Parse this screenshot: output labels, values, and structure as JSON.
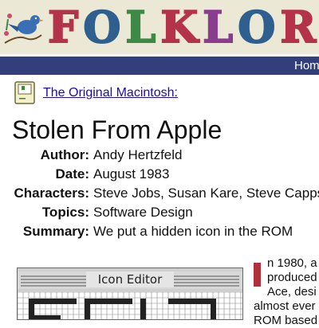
{
  "banner": {
    "logo_text": "FOLKLORE",
    "logo_colors": [
      "#b5334a",
      "#2f5f8f",
      "#3d8a46",
      "#b5334a",
      "#8a3d8f",
      "#2f5f8f",
      "#b5334a",
      "#3d8a46"
    ],
    "bird_icon": "bluebird-icon"
  },
  "nav": {
    "home_label": "Home"
  },
  "section": {
    "icon": "macintosh-icon",
    "link_text": "The Original Macintosh:"
  },
  "story": {
    "title": "Stolen From Apple",
    "meta": [
      {
        "label": "Author:",
        "value": "Andy Hertzfeld"
      },
      {
        "label": "Date:",
        "value": "August 1983"
      },
      {
        "label": "Characters:",
        "value": "Steve Jobs, Susan Kare, Steve Capps"
      },
      {
        "label": "Topics:",
        "value": "Software Design"
      },
      {
        "label": "Summary:",
        "value": "We put a hidden icon in the ROM"
      }
    ],
    "image_caption_text": "Icon Editor",
    "dropcap_color": "#b0303c",
    "body_lines": [
      "n 1980, a",
      "produced",
      "Ace, desi",
      "almost ever",
      "ROM based"
    ]
  }
}
